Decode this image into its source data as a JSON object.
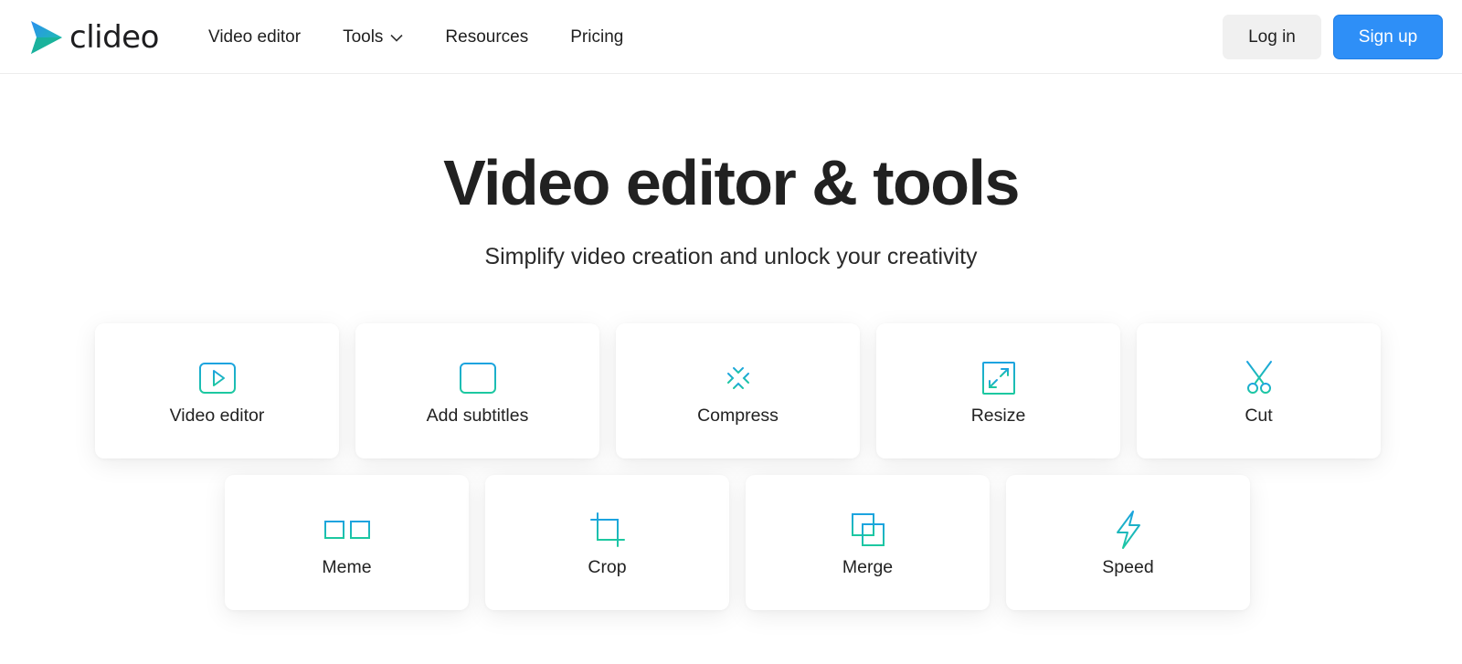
{
  "brand": {
    "name": "clideo"
  },
  "nav": {
    "items": [
      {
        "label": "Video editor"
      },
      {
        "label": "Tools",
        "has_dropdown": true
      },
      {
        "label": "Resources"
      },
      {
        "label": "Pricing"
      }
    ]
  },
  "auth": {
    "login_label": "Log in",
    "signup_label": "Sign up"
  },
  "hero": {
    "title": "Video editor & tools",
    "subtitle": "Simplify video creation and unlock your creativity"
  },
  "tools": [
    {
      "label": "Video editor",
      "icon": "play-icon"
    },
    {
      "label": "Add subtitles",
      "icon": "subtitles-icon"
    },
    {
      "label": "Compress",
      "icon": "compress-icon"
    },
    {
      "label": "Resize",
      "icon": "resize-icon"
    },
    {
      "label": "Cut",
      "icon": "scissors-icon"
    },
    {
      "label": "Meme",
      "icon": "meme-icon"
    },
    {
      "label": "Crop",
      "icon": "crop-icon"
    },
    {
      "label": "Merge",
      "icon": "merge-icon"
    },
    {
      "label": "Speed",
      "icon": "lightning-icon"
    }
  ],
  "colors": {
    "accent_blue": "#2e8ff7",
    "icon_gradient_start": "#1ca3e0",
    "icon_gradient_end": "#1cc8a0",
    "text": "#1f1f1f"
  }
}
